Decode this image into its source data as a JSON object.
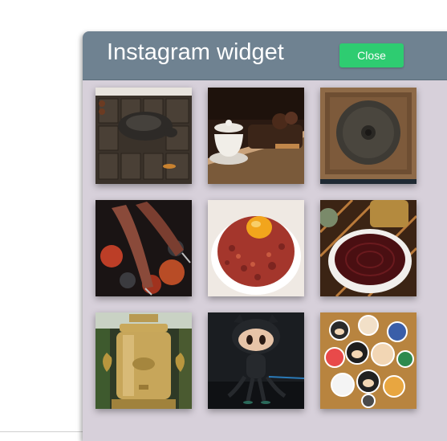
{
  "widget": {
    "title": "Instagram widget",
    "close_label": "Close",
    "colors": {
      "header_bg": "#6f8291",
      "panel_bg": "#d7d0da",
      "close_button_bg": "#2ecc71"
    }
  },
  "photos": [
    {
      "subject": "dark-stone-turtle-on-tea-brick"
    },
    {
      "subject": "white-gaiwan-teacup-and-teapot"
    },
    {
      "subject": "pressed-puerh-tea-cake-on-wooden-tray"
    },
    {
      "subject": "meat-skewers-over-glowing-coals"
    },
    {
      "subject": "steak-tartare-with-egg-yolk"
    },
    {
      "subject": "red-tea-in-white-bowl"
    },
    {
      "subject": "brass-samovar"
    },
    {
      "subject": "octocat-figurine"
    },
    {
      "subject": "pile-of-octocat-stickers"
    }
  ]
}
